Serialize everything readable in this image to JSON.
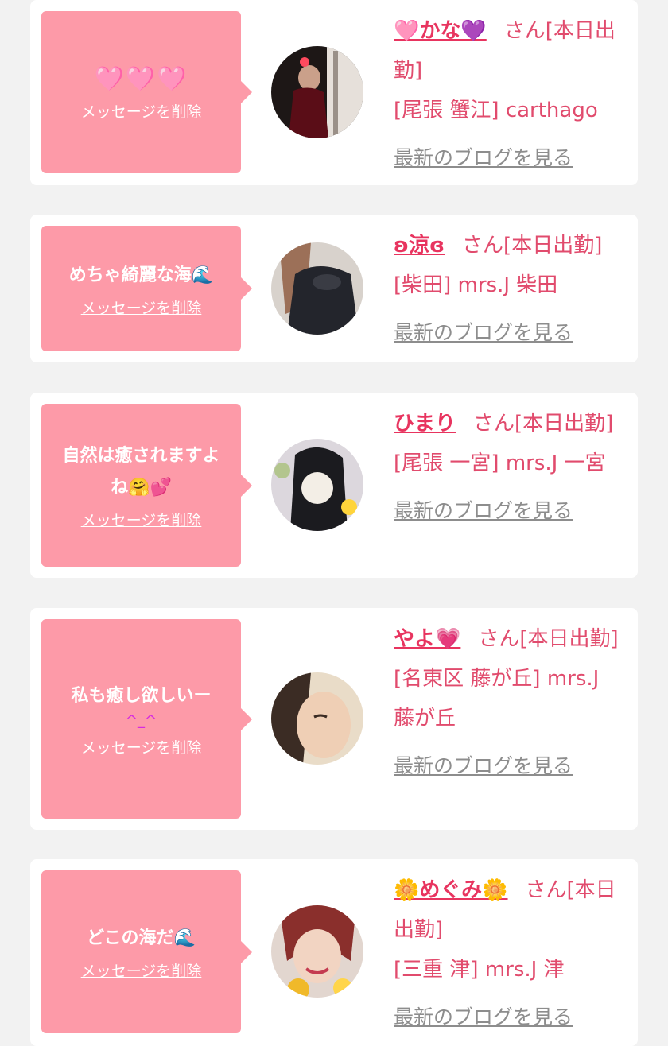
{
  "delete_label": "メッセージを削除",
  "blog_label": "最新のブログを見る",
  "san_suffix": "さん[本日出勤]",
  "cards": [
    {
      "message": "🩷🩷🩷",
      "name": "🩷かな💜",
      "shop": "[尾張 蟹江] carthago"
    },
    {
      "message": "めちゃ綺麗な海🌊",
      "name": "ʚ涼ɞ",
      "shop": "[柴田] mrs.J 柴田"
    },
    {
      "message": "自然は癒されますよね🤗💕",
      "name": "ひまり",
      "shop": "[尾張 一宮] mrs.J 一宮"
    },
    {
      "message": "私も癒し欲しいー",
      "message_extra": "^_^",
      "name": "やよ💗",
      "shop": "[名東区 藤が丘] mrs.J 藤が丘"
    },
    {
      "message": "どこの海だ🌊",
      "name": "🌼めぐみ🌼",
      "shop": "[三重 津] mrs.J 津"
    }
  ],
  "colors": {
    "bubble": "#fd9aa8",
    "name": "#e8345f",
    "text": "#e14b6d",
    "blog_link": "#8d8d8d"
  }
}
